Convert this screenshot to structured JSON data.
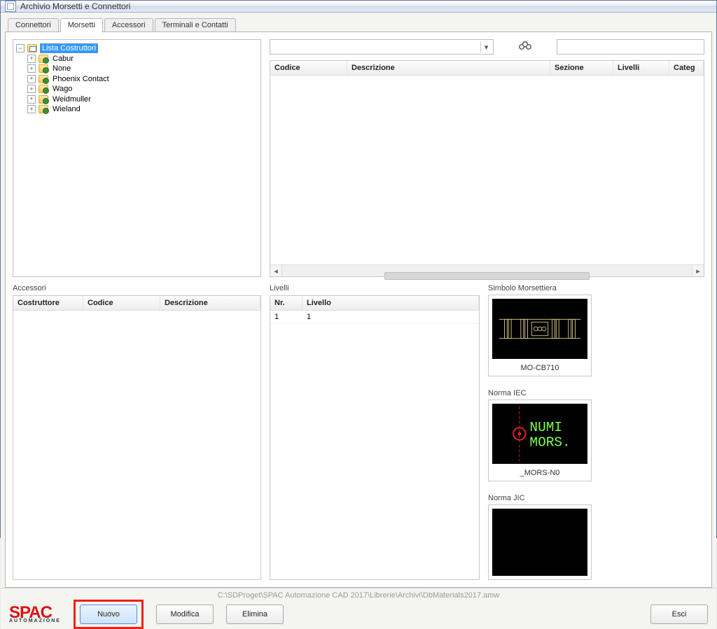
{
  "window": {
    "title": "Archivio Morsetti e Connettori"
  },
  "tabs": [
    {
      "label": "Connettori"
    },
    {
      "label": "Morsetti"
    },
    {
      "label": "Accessori"
    },
    {
      "label": "Terminali e Contatti"
    }
  ],
  "tree": {
    "root": "Lista Costruttori",
    "children": [
      {
        "label": "Cabur"
      },
      {
        "label": "None"
      },
      {
        "label": "Phoenix Contact"
      },
      {
        "label": "Wago"
      },
      {
        "label": "Weidmuller"
      },
      {
        "label": "Wieland"
      }
    ]
  },
  "maingrid": {
    "columns": {
      "codice": "Codice",
      "descrizione": "Descrizione",
      "sezione": "Sezione",
      "livelli": "Livelli",
      "categoria": "Categ"
    }
  },
  "accessori": {
    "title": "Accessori",
    "columns": {
      "costruttore": "Costruttore",
      "codice": "Codice",
      "descrizione": "Descrizione"
    }
  },
  "livelli": {
    "title": "Livelli",
    "columns": {
      "nr": "Nr.",
      "livello": "Livello"
    },
    "rows": [
      {
        "nr": "1",
        "livello": "1"
      }
    ]
  },
  "previews": {
    "simbolo": {
      "title": "Simbolo Morsettiera",
      "caption": "MO-CB710"
    },
    "normaIEC": {
      "title": "Norma IEC",
      "caption": "_MORS-N0",
      "line1": "NUMI",
      "line2": "MORS."
    },
    "normaJIC": {
      "title": "Norma JIC"
    }
  },
  "footer": {
    "path": "C:\\SDProget\\SPAC Automazione CAD 2017\\Librerie\\Archivi\\DbMaterials2017.amw",
    "buttons": {
      "nuovo": "Nuovo",
      "modifica": "Modifica",
      "elimina": "Elimina",
      "esci": "Esci"
    },
    "logo": "SPAC",
    "logo_sub": "AUTOMAZIONE"
  }
}
